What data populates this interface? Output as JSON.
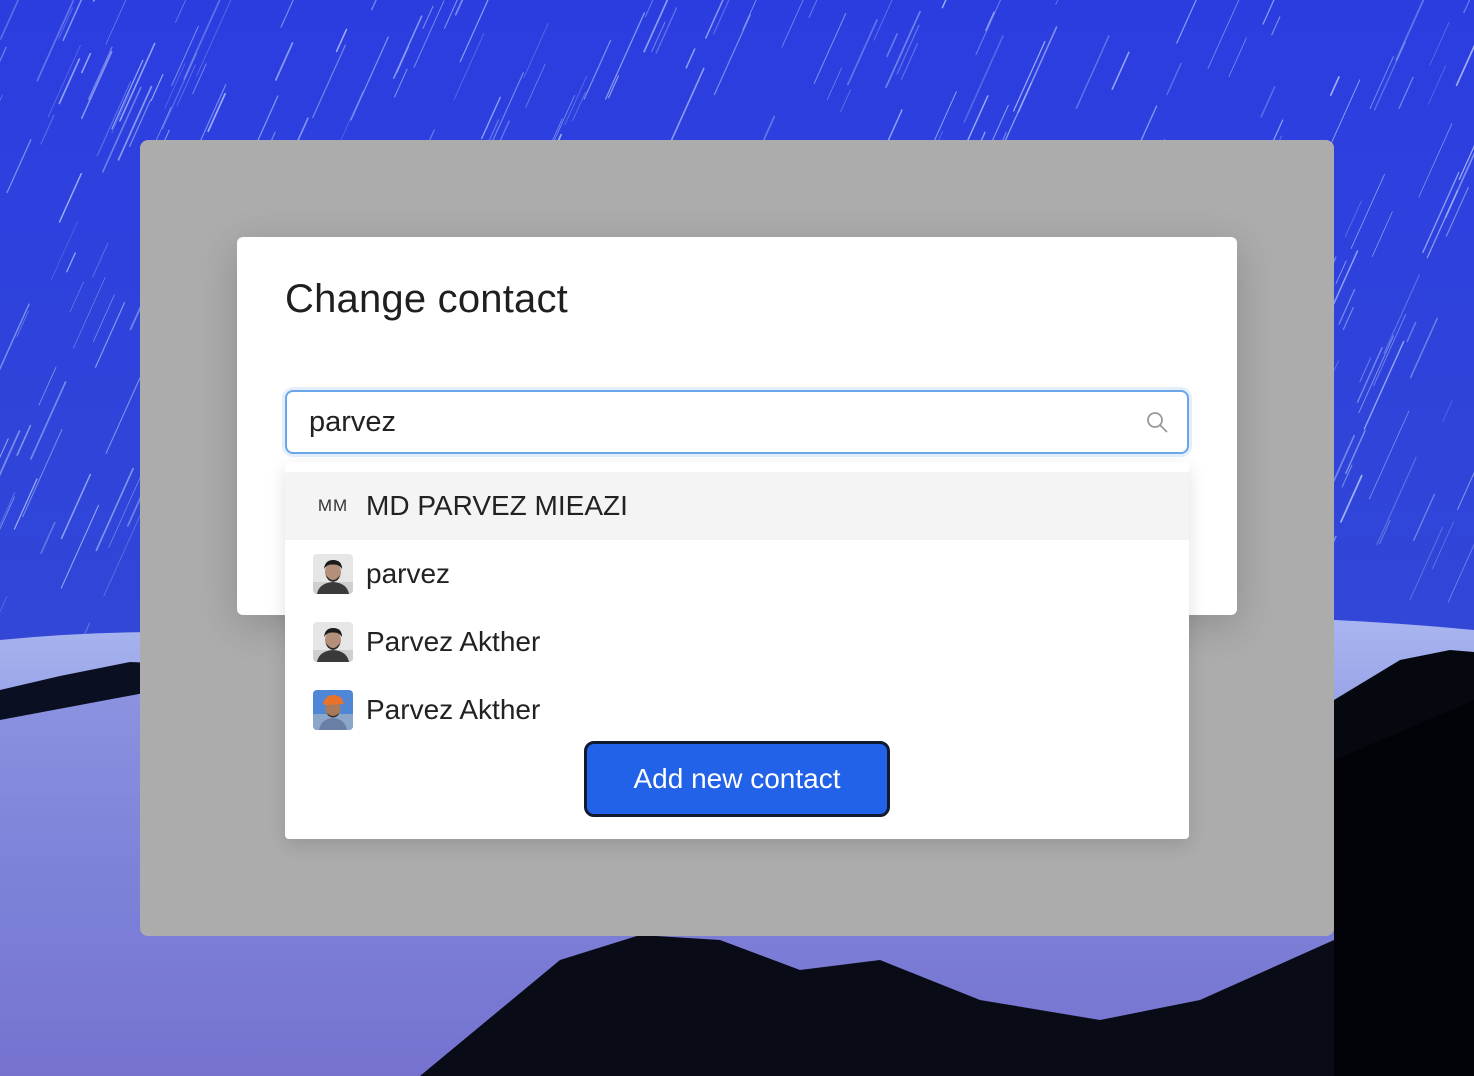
{
  "modal": {
    "title": "Change contact"
  },
  "search": {
    "value": "parvez",
    "icon": "search-icon"
  },
  "results": [
    {
      "avatar_type": "initials",
      "initials": "MM",
      "name": "MD PARVEZ MIEAZI",
      "highlighted": true
    },
    {
      "avatar_type": "photo",
      "name": "parvez",
      "highlighted": false
    },
    {
      "avatar_type": "photo",
      "name": "Parvez Akther",
      "highlighted": false
    },
    {
      "avatar_type": "photo",
      "name": "Parvez Akther",
      "highlighted": false
    }
  ],
  "actions": {
    "add_contact_label": "Add new contact"
  },
  "colors": {
    "accent": "#2162e8",
    "focus_border": "#6aa6e8",
    "overlay": "#acacac",
    "highlight_row": "#f4f4f4"
  }
}
